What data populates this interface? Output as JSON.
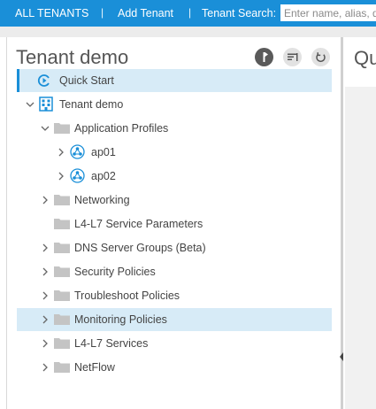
{
  "topbar": {
    "all_tenants": "ALL TENANTS",
    "sep1": "|",
    "add_tenant": "Add Tenant",
    "sep2": "|",
    "search_label": "Tenant Search:",
    "search_placeholder": "Enter name, alias, descr"
  },
  "panel": {
    "title": "Tenant demo"
  },
  "right_panel": {
    "title": "Qu"
  },
  "tree": {
    "quick_start": "Quick Start",
    "tenant": "Tenant demo",
    "app_profiles": "Application Profiles",
    "ap01": "ap01",
    "ap02": "ap02",
    "networking": "Networking",
    "l4l7_params": "L4-L7 Service Parameters",
    "dns_groups": "DNS Server Groups (Beta)",
    "security": "Security Policies",
    "troubleshoot": "Troubleshoot Policies",
    "monitoring": "Monitoring Policies",
    "l4l7_services": "L4-L7 Services",
    "netflow": "NetFlow"
  },
  "colors": {
    "accent": "#1a8fd8",
    "selection": "#d7ebf7",
    "folder": "#c4c4c4",
    "text": "#444444"
  }
}
